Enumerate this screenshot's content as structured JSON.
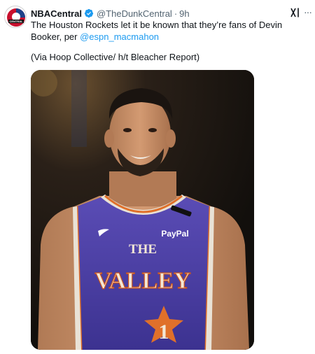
{
  "tweet": {
    "author_name": "NBACentral",
    "handle": "@TheDunkCentral",
    "separator": "·",
    "time": "9h",
    "text": "The Houston Rockets let it be known that they’re fans of Devin Booker, per ",
    "mention": "@espn_macmahon",
    "credit": "(Via Hoop Collective/ h/t Bleacher Report)",
    "more_label": "···",
    "icons": {
      "avatar": "nbacentral-logo",
      "verified": "verified-badge-icon",
      "grok": "grok-icon",
      "more": "more-options-icon"
    }
  },
  "media": {
    "jersey_top": "THE",
    "jersey_main": "VALLEY",
    "jersey_number": "1",
    "sponsor": "PayPal"
  },
  "colors": {
    "link": "#1d9bf0",
    "verified": "#1d9bf0",
    "secondary_text": "#536471",
    "jersey": "#4b3fa0"
  }
}
